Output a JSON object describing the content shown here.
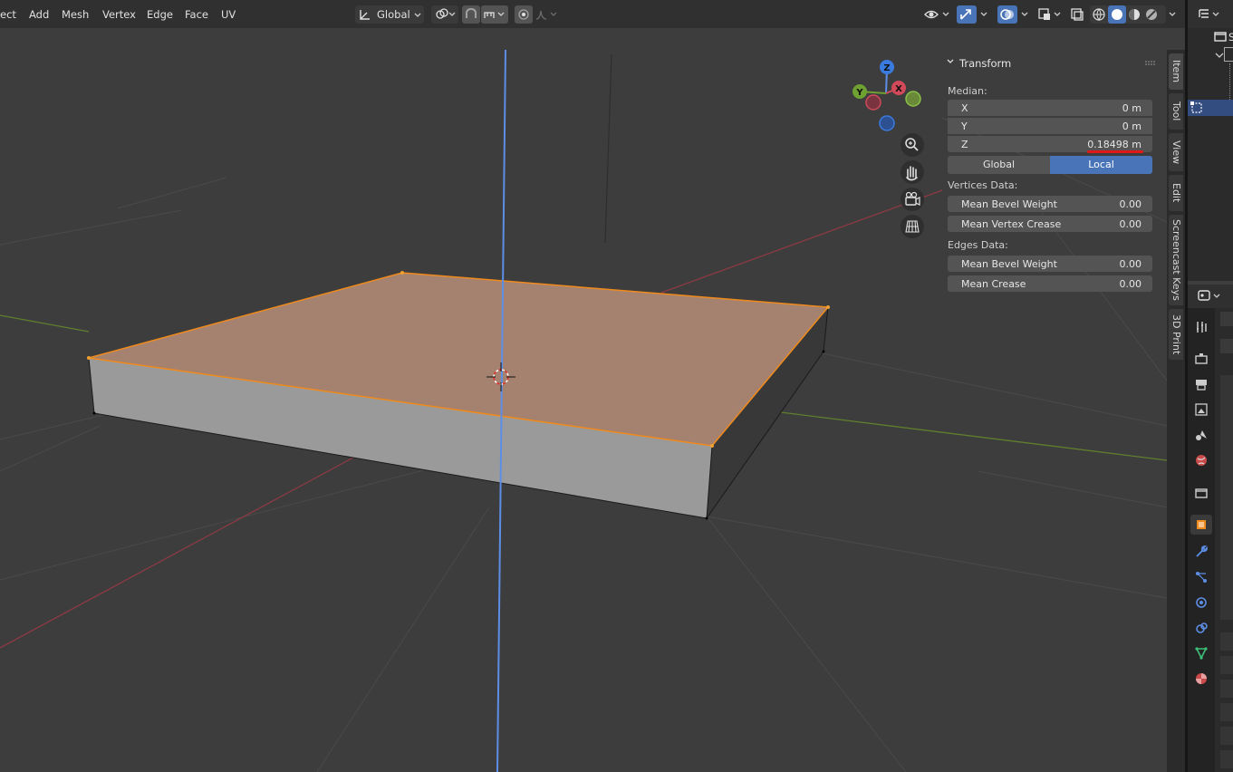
{
  "header": {
    "menu": [
      "ect",
      "Add",
      "Mesh",
      "Vertex",
      "Edge",
      "Face",
      "UV"
    ],
    "orientation": "Global"
  },
  "navigation": {
    "gizmo_axes": [
      "Z",
      "Y",
      "X"
    ],
    "tools": [
      "zoom-icon",
      "hand-pan-icon",
      "camera-icon",
      "grid-icon"
    ]
  },
  "npanel": {
    "title": "Transform",
    "median_label": "Median:",
    "fields": [
      {
        "label": "X",
        "value": "0 m"
      },
      {
        "label": "Y",
        "value": "0 m"
      },
      {
        "label": "Z",
        "value": "0.18498 m"
      }
    ],
    "space_options": [
      "Global",
      "Local"
    ],
    "selected_space": "Local",
    "vertices_label": "Vertices Data:",
    "vertices": [
      {
        "label": "Mean Bevel Weight",
        "value": "0.00"
      },
      {
        "label": "Mean Vertex Crease",
        "value": "0.00"
      }
    ],
    "edges_label": "Edges Data:",
    "edges": [
      {
        "label": "Mean Bevel Weight",
        "value": "0.00"
      },
      {
        "label": "Mean Crease",
        "value": "0.00"
      }
    ]
  },
  "side_tabs": [
    "Item",
    "Tool",
    "View",
    "Edit",
    "Screencast Keys",
    "3D Print"
  ],
  "outliner": {
    "partial_text": "S"
  },
  "colors": {
    "accent_blue": "#4a74b8",
    "selection_orange": "#f08a1c",
    "face_selected": "#a5826f",
    "axis_x": "#b3404f",
    "axis_y": "#6b9a2c",
    "axis_z": "#5d8ee6"
  }
}
